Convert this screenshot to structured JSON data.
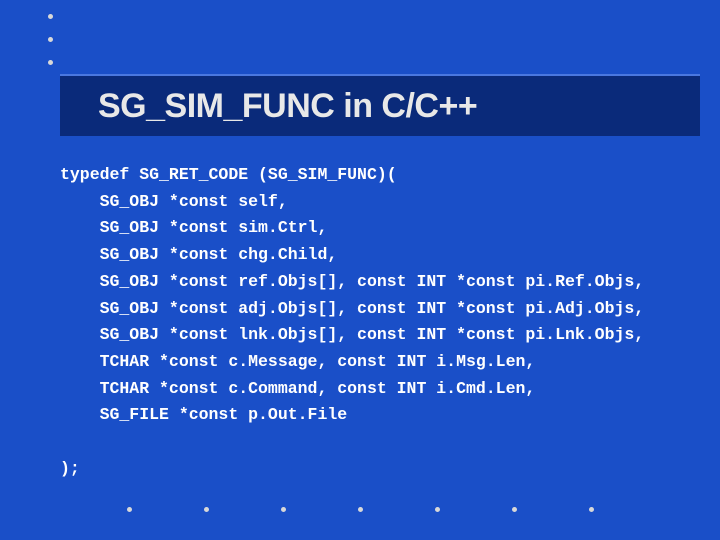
{
  "title": "SG_SIM_FUNC in C/C++",
  "code": {
    "l0": "typedef SG_RET_CODE (SG_SIM_FUNC)(",
    "l1": "    SG_OBJ *const self,",
    "l2": "    SG_OBJ *const sim.Ctrl,",
    "l3": "    SG_OBJ *const chg.Child,",
    "l4": "    SG_OBJ *const ref.Objs[], const INT *const pi.Ref.Objs,",
    "l5": "    SG_OBJ *const adj.Objs[], const INT *const pi.Adj.Objs,",
    "l6": "    SG_OBJ *const lnk.Objs[], const INT *const pi.Lnk.Objs,",
    "l7": "    TCHAR *const c.Message, const INT i.Msg.Len,",
    "l8": "    TCHAR *const c.Command, const INT i.Cmd.Len,",
    "l9": "    SG_FILE *const p.Out.File",
    "l10": "",
    "l11": ");"
  }
}
